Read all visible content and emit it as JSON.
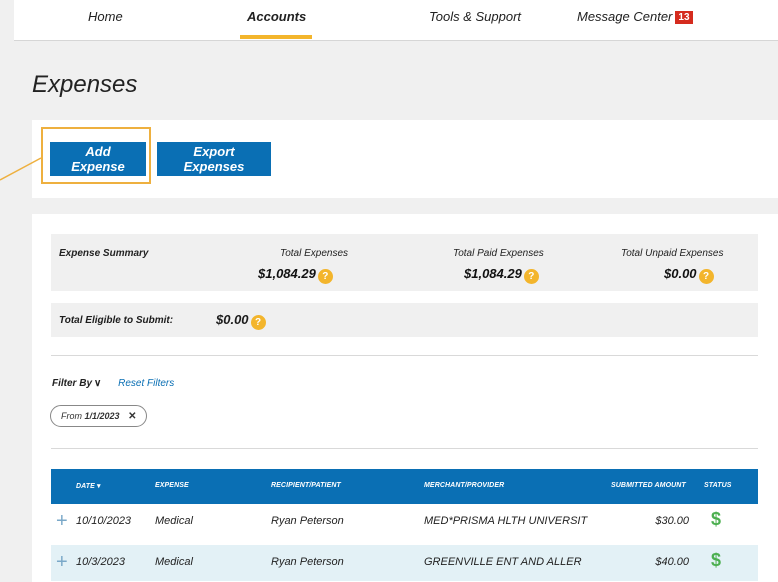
{
  "nav": {
    "tabs": [
      {
        "label": "Home"
      },
      {
        "label": "Accounts"
      },
      {
        "label": "Tools & Support"
      },
      {
        "label": "Message Center"
      }
    ],
    "message_count": "13"
  },
  "page": {
    "title": "Expenses"
  },
  "actions": {
    "add_label": "Add Expense",
    "export_label": "Export Expenses"
  },
  "summary": {
    "heading": "Expense Summary",
    "total_expenses_label": "Total Expenses",
    "total_expenses_value": "$1,084.29",
    "total_paid_label": "Total Paid Expenses",
    "total_paid_value": "$1,084.29",
    "total_unpaid_label": "Total Unpaid Expenses",
    "total_unpaid_value": "$0.00",
    "eligible_label": "Total Eligible to Submit:",
    "eligible_value": "$0.00"
  },
  "filters": {
    "filter_by_label": "Filter By",
    "reset_label": "Reset Filters",
    "chip_prefix": "From",
    "chip_value": "1/1/2023"
  },
  "table": {
    "headers": {
      "date": "DATE",
      "expense": "EXPENSE",
      "recipient": "RECIPIENT/PATIENT",
      "merchant": "MERCHANT/PROVIDER",
      "amount": "SUBMITTED AMOUNT",
      "status": "STATUS"
    },
    "rows": [
      {
        "date": "10/10/2023",
        "expense": "Medical",
        "recipient": "Ryan Peterson",
        "merchant": "MED*PRISMA HLTH UNIVERSIT",
        "amount": "$30.00",
        "status_icon": "dollar-icon"
      },
      {
        "date": "10/3/2023",
        "expense": "Medical",
        "recipient": "Ryan Peterson",
        "merchant": "GREENVILLE ENT AND ALLER",
        "amount": "$40.00",
        "status_icon": "dollar-icon"
      }
    ]
  },
  "colors": {
    "primary": "#0a6fb4",
    "accent": "#f3b52c",
    "badge": "#d52b1e",
    "status_paid": "#4caf50",
    "row_alt": "#e3f1f6"
  }
}
